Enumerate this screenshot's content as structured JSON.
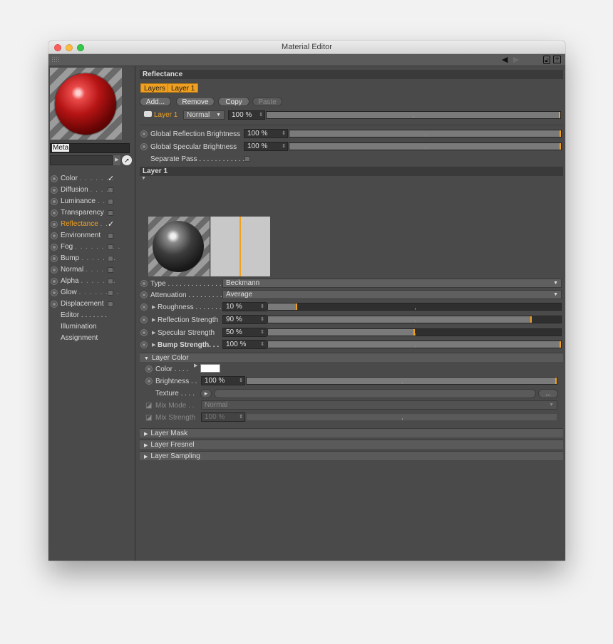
{
  "window": {
    "title": "Material Editor"
  },
  "material": {
    "name": "Meta"
  },
  "channels": [
    {
      "label": "Color",
      "dots": ". . . . . . .",
      "checked": true
    },
    {
      "label": "Diffusion",
      "dots": ". . . .",
      "checked": false
    },
    {
      "label": "Luminance",
      "dots": ". .",
      "checked": false
    },
    {
      "label": "Transparency",
      "dots": "",
      "checked": false
    },
    {
      "label": "Reflectance",
      "dots": ". .",
      "checked": true,
      "active": true
    },
    {
      "label": "Environment",
      "dots": "",
      "checked": false
    },
    {
      "label": "Fog",
      "dots": ". . . . . . . . .",
      "checked": false
    },
    {
      "label": "Bump",
      "dots": ". . . . . . .",
      "checked": false
    },
    {
      "label": "Normal",
      "dots": ". . . . . .",
      "checked": false
    },
    {
      "label": "Alpha",
      "dots": ". . . . . . .",
      "checked": false
    },
    {
      "label": "Glow",
      "dots": ". . . . . . . .",
      "checked": false
    },
    {
      "label": "Displacement",
      "dots": "",
      "checked": false
    }
  ],
  "extras": [
    "Editor . . . . . . .",
    "Illumination",
    "Assignment"
  ],
  "reflectance": {
    "header": "Reflectance",
    "tabs": [
      "Layers",
      "Layer 1"
    ],
    "buttons": {
      "add": "Add...",
      "remove": "Remove",
      "copy": "Copy",
      "paste": "Paste"
    },
    "layer_row": {
      "name": "Layer 1",
      "blend": "Normal",
      "value": "100 %",
      "fraction": 1.0
    },
    "global_reflection": {
      "label": "Global Reflection Brightness",
      "value": "100 %",
      "fraction": 1.0
    },
    "global_specular": {
      "label": "Global Specular Brightness",
      "value": "100 %",
      "fraction": 1.0
    },
    "separate_pass": {
      "label": "Separate Pass . . . . . . . . . . . ."
    }
  },
  "layer1": {
    "header": "Layer 1",
    "type": {
      "label": "Type . . . . . . . . . . . . . . .",
      "value": "Beckmann"
    },
    "attenuation": {
      "label": "Attenuation . . . . . . . . .",
      "value": "Average"
    },
    "roughness": {
      "label": "Roughness . . . . . . .",
      "value": "10 %",
      "fraction": 0.1
    },
    "reflection_strength": {
      "label": "Reflection Strength",
      "value": "90 %",
      "fraction": 0.9
    },
    "specular_strength": {
      "label": "Specular Strength",
      "value": "50 %",
      "fraction": 0.5
    },
    "bump_strength": {
      "label": "Bump Strength. . .",
      "value": "100 %",
      "fraction": 1.0
    }
  },
  "layer_color": {
    "header": "Layer Color",
    "color": {
      "label": "Color . . . .",
      "swatch": "#ffffff"
    },
    "brightness": {
      "label": "Brightness . .",
      "value": "100 %",
      "fraction": 1.0
    },
    "texture": {
      "label": "Texture . . . .",
      "more": "..."
    },
    "mix_mode": {
      "label": "Mix Mode . .",
      "value": "Normal"
    },
    "mix_strength": {
      "label": "Mix Strength",
      "value": "100 %"
    }
  },
  "collapsed_sections": [
    "Layer Mask",
    "Layer Fresnel",
    "Layer Sampling"
  ],
  "colors": {
    "accent": "#f0a020",
    "panel": "#4a4a4a",
    "header": "#3a3a3a"
  }
}
